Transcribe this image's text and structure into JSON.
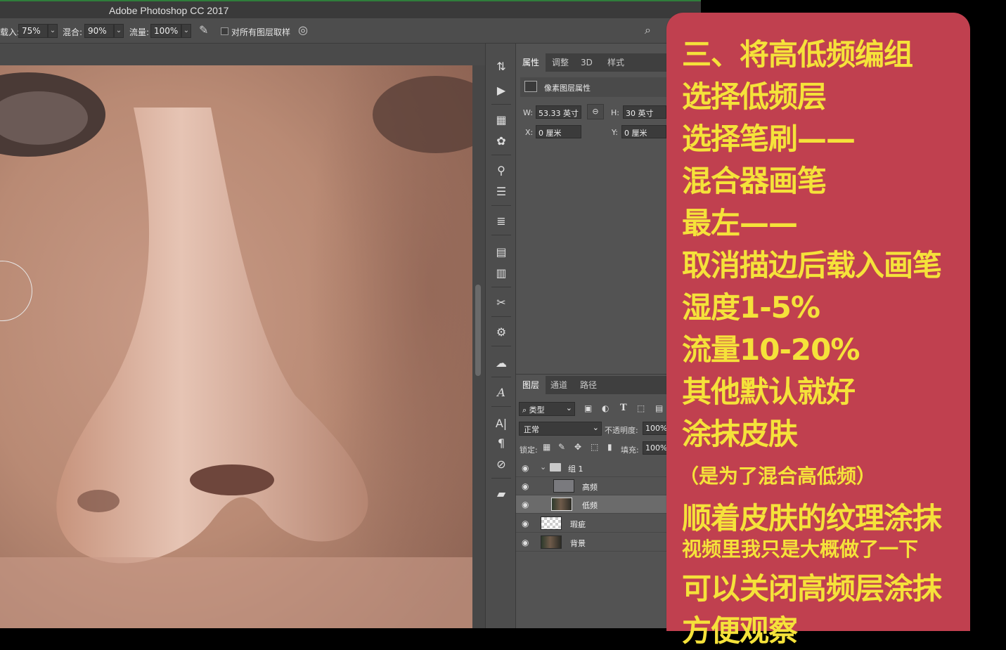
{
  "window": {
    "title": "Adobe Photoshop CC 2017"
  },
  "options_bar": {
    "load_label": "载入:",
    "load_value": "75%",
    "mix_label": "混合:",
    "mix_value": "90%",
    "flow_label": "流量:",
    "flow_value": "100%",
    "sample_all_label": "对所有图层取样"
  },
  "properties_panel": {
    "tabs": [
      "属性",
      "调整",
      "3D",
      "样式"
    ],
    "header": "像素图层属性",
    "w_label": "W:",
    "w_value": "53.33 英寸",
    "h_label": "H:",
    "h_value": "30 英寸",
    "x_label": "X:",
    "x_value": "0 厘米",
    "y_label": "Y:",
    "y_value": "0 厘米"
  },
  "layers_panel": {
    "tabs": [
      "图层",
      "通道",
      "路径"
    ],
    "filter_kind": "类型",
    "blend_mode": "正常",
    "opacity_label": "不透明度:",
    "opacity_value": "100%",
    "lock_label": "锁定:",
    "fill_label": "填充:",
    "fill_value": "100%",
    "layers": [
      {
        "name": "组 1",
        "type": "group"
      },
      {
        "name": "高频",
        "type": "gray"
      },
      {
        "name": "低频",
        "type": "photo",
        "selected": true
      },
      {
        "name": "瑕疵",
        "type": "transparent"
      },
      {
        "name": "背景",
        "type": "photo"
      }
    ]
  },
  "overlay": {
    "background": "#c0404f",
    "text_color": "#f5e23a",
    "lines": [
      "三、将高低频编组",
      "选择低频层",
      "选择笔刷——",
      "混合器画笔",
      "最左——",
      "取消描边后载入画笔",
      "湿度1-5%",
      "流量10-20%",
      "其他默认就好",
      "涂抹皮肤",
      "（是为了混合高低频）",
      "顺着皮肤的纹理涂抹",
      "视频里我只是大概做了一下",
      "可以关闭高频层涂抹",
      "方便观察"
    ]
  }
}
